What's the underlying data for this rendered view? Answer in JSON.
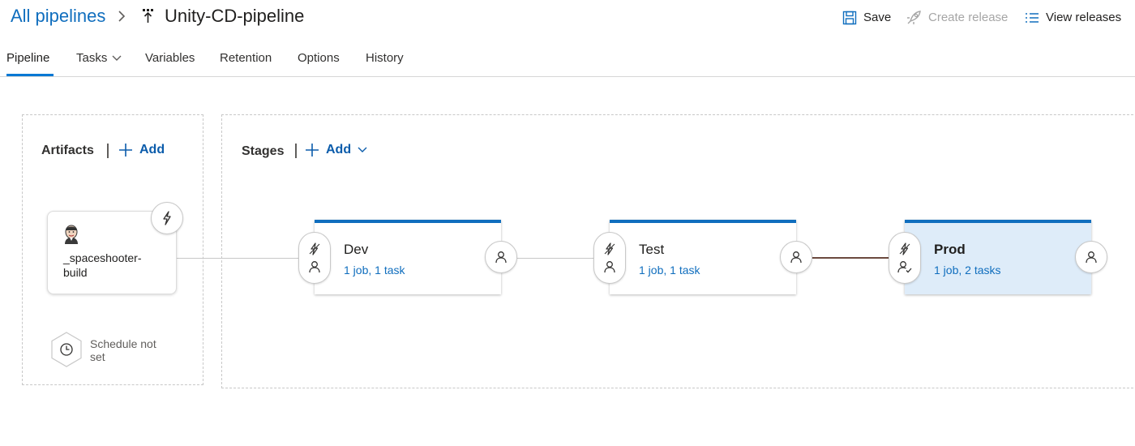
{
  "header": {
    "breadcrumb_root": "All pipelines",
    "title": "Unity-CD-pipeline",
    "commands": {
      "save": "Save",
      "create_release": "Create release",
      "view_releases": "View releases"
    }
  },
  "tabs": [
    {
      "label": "Pipeline",
      "active": true
    },
    {
      "label": "Tasks",
      "dropdown": true
    },
    {
      "label": "Variables"
    },
    {
      "label": "Retention"
    },
    {
      "label": "Options"
    },
    {
      "label": "History"
    }
  ],
  "artifacts": {
    "title": "Artifacts",
    "add_label": "Add",
    "items": [
      {
        "name": "_spaceshooter-build",
        "icon": "jenkins-icon",
        "trigger_icon": "lightning-icon"
      }
    ],
    "schedule_label": "Schedule not set"
  },
  "stages": {
    "title": "Stages",
    "add_label": "Add",
    "items": [
      {
        "name": "Dev",
        "summary": "1 job, 1 task",
        "selected": false
      },
      {
        "name": "Test",
        "summary": "1 job, 1 task",
        "selected": false
      },
      {
        "name": "Prod",
        "summary": "1 job, 2 tasks",
        "selected": true
      }
    ]
  },
  "colors": {
    "accent": "#106ebe",
    "link": "#0b5cab",
    "selected_stage_bg": "#deecf9",
    "disabled_text": "#a6a6a6"
  }
}
